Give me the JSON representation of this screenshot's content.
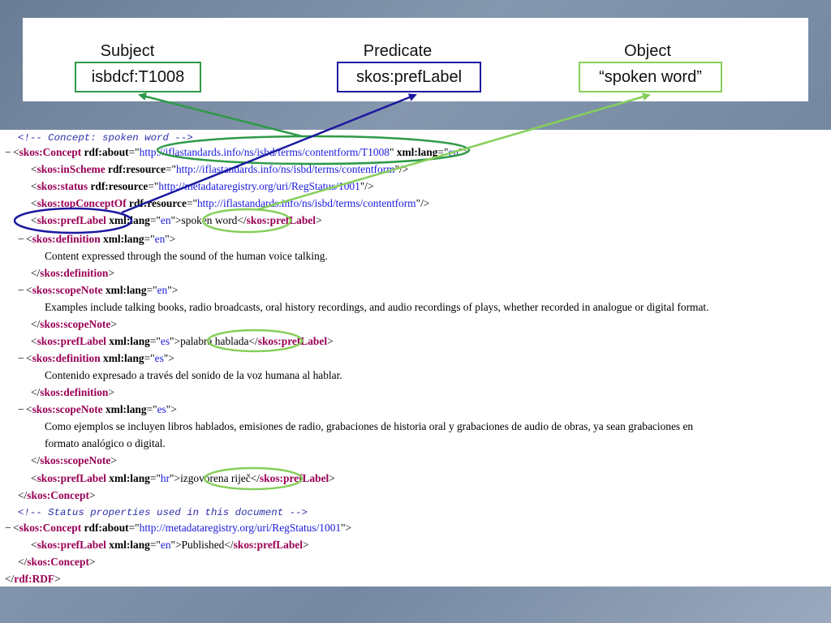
{
  "columns": {
    "subject": "Subject",
    "predicate": "Predicate",
    "object": "Object"
  },
  "triple": {
    "subject": "isbdcf:T1008",
    "predicate": "skos:prefLabel",
    "object": "“spoken word”"
  },
  "xml": {
    "comment1": "<!-- Concept: spoken word -->",
    "concept_open_tag": "skos:Concept",
    "about_attr": "rdf:about",
    "concept_uri": "http://iflastandards.info/ns/isbd/terms/contentform/T1008",
    "lang_attr": "xml:lang",
    "lang_en": "en",
    "inScheme_tag": "skos:inScheme",
    "resource_attr": "rdf:resource",
    "scheme_uri": "http://iflastandards.info/ns/isbd/terms/contentform",
    "status_tag": "skos:status",
    "status_uri": "http://metadataregistry.org/uri/RegStatus/1001",
    "topConcept_tag": "skos:topConceptOf",
    "topConcept_uri": "http://iflastandards.info/ns/isbd/terms/contentform",
    "prefLabel_tag": "skos:prefLabel",
    "label_en": "spoken word",
    "definition_tag": "skos:definition",
    "definition_en": "Content expressed through the sound of the human voice talking.",
    "scopeNote_tag": "skos:scopeNote",
    "scope_en": "Examples include talking books, radio broadcasts, oral history recordings, and audio recordings of plays, whether recorded in analogue or digital format.",
    "lang_es": "es",
    "label_es": "palabra hablada",
    "definition_es": "Contenido expresado a través del sonido de la voz humana al hablar.",
    "scope_es_1": "Como ejemplos se incluyen libros hablados, emisiones de radio, grabaciones de historia oral y grabaciones de audio de obras, ya sean grabaciones en",
    "scope_es_2": "formato analógico o digital.",
    "lang_hr": "hr",
    "label_hr": "izgovorena riječ",
    "comment2": "<!-- Status properties used in this document -->",
    "status_concept_uri": "http://metadataregistry.org/uri/RegStatus/1001",
    "label_published": "Published",
    "rdf_tag": "rdf:RDF"
  },
  "colors": {
    "subject_link": "#2e9a48",
    "predicate_link": "#1a1aa0",
    "object_link": "#86cf5a"
  }
}
